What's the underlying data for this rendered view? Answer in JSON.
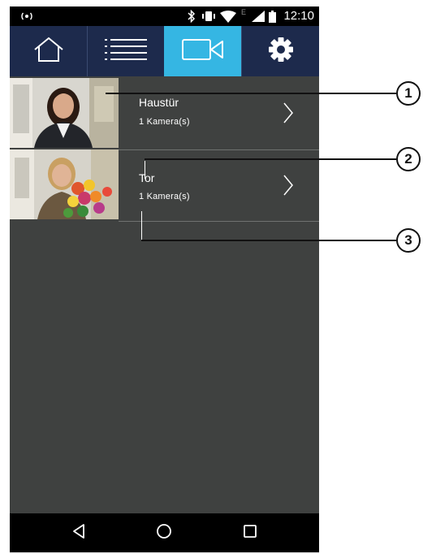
{
  "statusbar": {
    "clock": "12:10",
    "network_letter": "E",
    "icons": [
      "cast-icon",
      "bluetooth-icon",
      "vibrate-icon",
      "wifi-icon",
      "signal-icon",
      "battery-icon"
    ]
  },
  "tabs": [
    {
      "name": "home",
      "icon": "home-icon",
      "active": false
    },
    {
      "name": "list",
      "icon": "list-icon",
      "active": false
    },
    {
      "name": "video",
      "icon": "video-camera-icon",
      "active": true
    },
    {
      "name": "settings",
      "icon": "gear-icon",
      "active": false
    }
  ],
  "cameras": [
    {
      "title": "Haustür",
      "subtitle": "1 Kamera(s)"
    },
    {
      "title": "Tor",
      "subtitle": "1 Kamera(s)"
    }
  ],
  "callouts": [
    "1",
    "2",
    "3"
  ],
  "colors": {
    "tabbar": "#1d2a4c",
    "active_tab": "#35b6e3",
    "background": "#3f4140"
  }
}
